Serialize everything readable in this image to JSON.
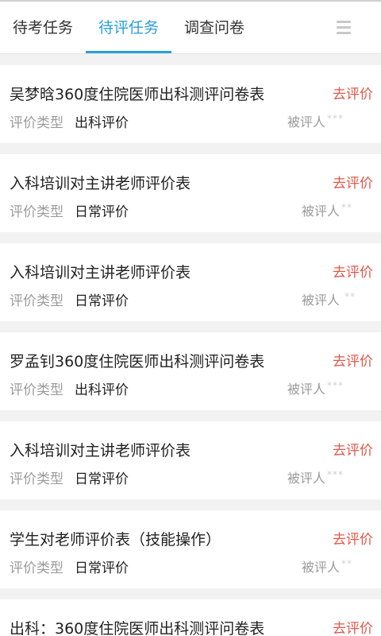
{
  "tabs": [
    {
      "label": "待考任务",
      "active": false
    },
    {
      "label": "待评任务",
      "active": true
    },
    {
      "label": "调查问卷",
      "active": false
    }
  ],
  "menu_icon": "hamburger-menu-icon",
  "accent_color": "#2b9fd8",
  "action_color": "#e0584a",
  "type_label": "评价类型",
  "items": [
    {
      "title": "吴梦晗360度住院医师出科测评问卷表",
      "action": "去评价",
      "type": "出科评价",
      "evaluatee_label": "被评人",
      "masked": "***"
    },
    {
      "title": "入科培训对主讲老师评价表",
      "action": "去评价",
      "type": "日常评价",
      "evaluatee_label": "被评人",
      "masked": "**"
    },
    {
      "title": "入科培训对主讲老师评价表",
      "action": "去评价",
      "type": "日常评价",
      "evaluatee_label": "被评人",
      "masked": "**"
    },
    {
      "title": "罗孟钊360度住院医师出科测评问卷表",
      "action": "去评价",
      "type": "出科评价",
      "evaluatee_label": "被评人",
      "masked": "***"
    },
    {
      "title": "入科培训对主讲老师评价表",
      "action": "去评价",
      "type": "日常评价",
      "evaluatee_label": "被评人",
      "masked": "***"
    },
    {
      "title": "学生对老师评价表（技能操作）",
      "action": "去评价",
      "type": "日常评价",
      "evaluatee_label": "被评人",
      "masked": "**"
    },
    {
      "title": "出科：360度住院医师出科测评问卷表",
      "action": "去评价",
      "type": "",
      "evaluatee_label": "",
      "masked": ""
    }
  ]
}
